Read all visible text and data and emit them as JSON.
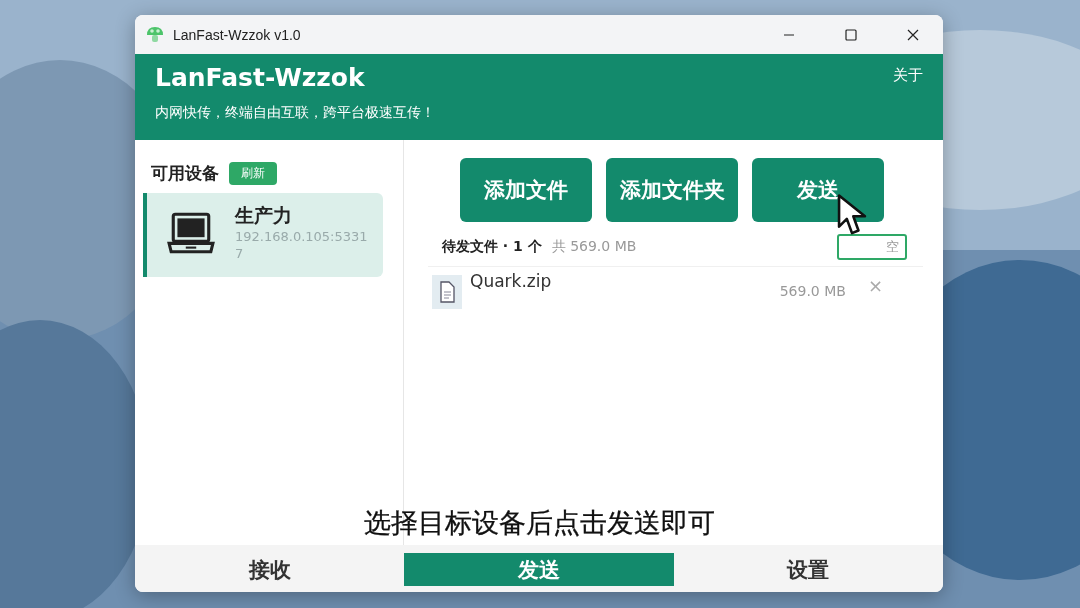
{
  "window": {
    "title": "LanFast-Wzzok v1.0"
  },
  "header": {
    "app_name": "LanFast-Wzzok",
    "about": "关于",
    "tagline": "内网快传，终端自由互联，跨平台极速互传！"
  },
  "sidebar": {
    "title": "可用设备",
    "refresh": "刷新",
    "devices": [
      {
        "name": "生产力",
        "address": "192.168.0.105:53317",
        "selected": true
      }
    ]
  },
  "actions": [
    "添加文件",
    "添加文件夹",
    "发送"
  ],
  "pending": {
    "label": "待发文件 · 1 个",
    "total": "共 569.0 MB",
    "clear": "空"
  },
  "files": [
    {
      "name": "Quark.zip",
      "size": "569.0 MB",
      "remove": "×"
    }
  ],
  "caption": "选择目标设备后点击发送即可",
  "nav": [
    {
      "label": "接收",
      "selected": false
    },
    {
      "label": "发送",
      "selected": true
    },
    {
      "label": "设置",
      "selected": false
    }
  ]
}
